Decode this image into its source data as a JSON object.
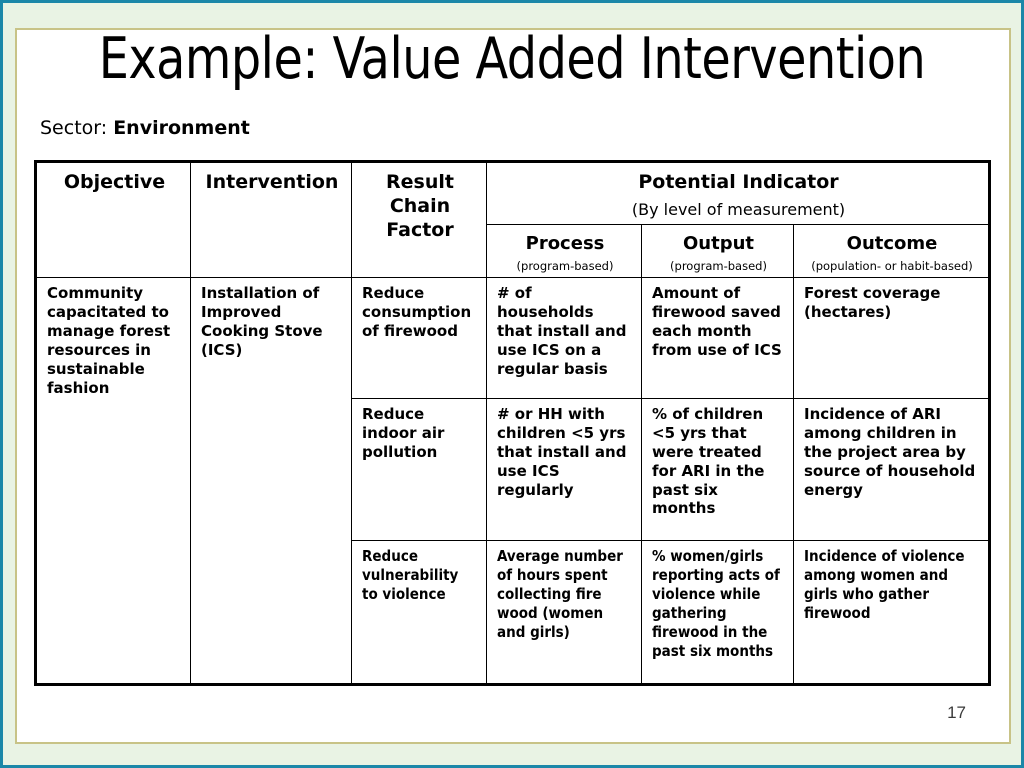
{
  "slide": {
    "title": "Example: Value Added Intervention",
    "sector_label": "Sector:",
    "sector_value": "Environment",
    "page_number": "17",
    "colors": {
      "frame_outer": "#1b87a8",
      "frame_band": "#e9f3e4",
      "frame_inner_line": "#c8c387",
      "table_border": "#000000",
      "text": "#000000"
    }
  },
  "table": {
    "headers": {
      "objective": "Objective",
      "intervention": "Intervention",
      "result_chain_factor": "Result\nChain\nFactor",
      "result_chain_factor_lines": [
        "Result",
        "Chain",
        "Factor"
      ],
      "potential_indicator": "Potential Indicator",
      "potential_indicator_sub": "(By level of measurement)",
      "levels": [
        {
          "title": "Process",
          "note": "(program-based)"
        },
        {
          "title": "Output",
          "note": "(program-based)"
        },
        {
          "title": "Outcome",
          "note": "(population- or habit-based)"
        }
      ]
    },
    "objective": "Community capacitated to manage forest resources in sustainable fashion",
    "intervention": "Installation of Improved Cooking Stove (ICS)",
    "rows": [
      {
        "result_chain_factor": "Reduce consumption of firewood",
        "process": "# of households that install and use ICS on a regular basis",
        "output": "Amount of firewood saved each month from use of ICS",
        "outcome": "Forest coverage (hectares)"
      },
      {
        "result_chain_factor": "Reduce indoor air pollution",
        "process": "# or HH with children <5 yrs that install and use ICS regularly",
        "output": "% of children <5 yrs that were treated for ARI in the past six months",
        "outcome": "Incidence of ARI among children in the project area by source of household energy"
      },
      {
        "result_chain_factor": "Reduce vulnerability to violence",
        "process": "Average number of hours spent collecting fire wood (women and girls)",
        "output": "% women/girls reporting acts of violence while gathering firewood in the past six months",
        "outcome": "Incidence of violence among women and girls who gather firewood"
      }
    ]
  }
}
